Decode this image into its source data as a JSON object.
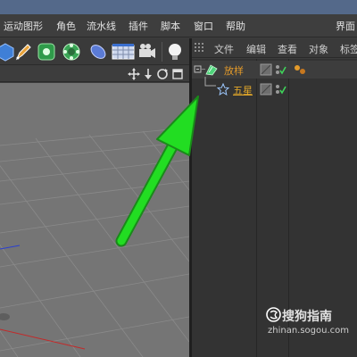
{
  "menu": {
    "items": [
      "运动图形",
      "角色",
      "流水线",
      "插件",
      "脚本",
      "窗口",
      "帮助"
    ],
    "right_label": "界面"
  },
  "toolbar": {
    "icons": [
      "cube-icon",
      "pen-icon",
      "gear-green-icon",
      "cog-green-icon",
      "capsule-icon",
      "floor-icon",
      "camera-icon",
      "light-icon"
    ]
  },
  "viewport_bar": {
    "icons": [
      "move-icon",
      "down-arrow-icon",
      "rotate-icon",
      "maximize-icon"
    ]
  },
  "object_manager": {
    "menus": [
      "文件",
      "编辑",
      "查看",
      "对象",
      "标签"
    ],
    "objects": [
      {
        "name": "放样",
        "icon": "loft-icon",
        "color": "#e39a2a"
      },
      {
        "name": "五星",
        "icon": "star-icon",
        "color": "#e3a82a"
      }
    ]
  },
  "watermark": {
    "title": "搜狗指南",
    "url": "zhinan.sogou.com"
  },
  "colors": {
    "arrow": "#22dd22",
    "orange": "#e39a2a",
    "titlebar": "#54698a"
  }
}
